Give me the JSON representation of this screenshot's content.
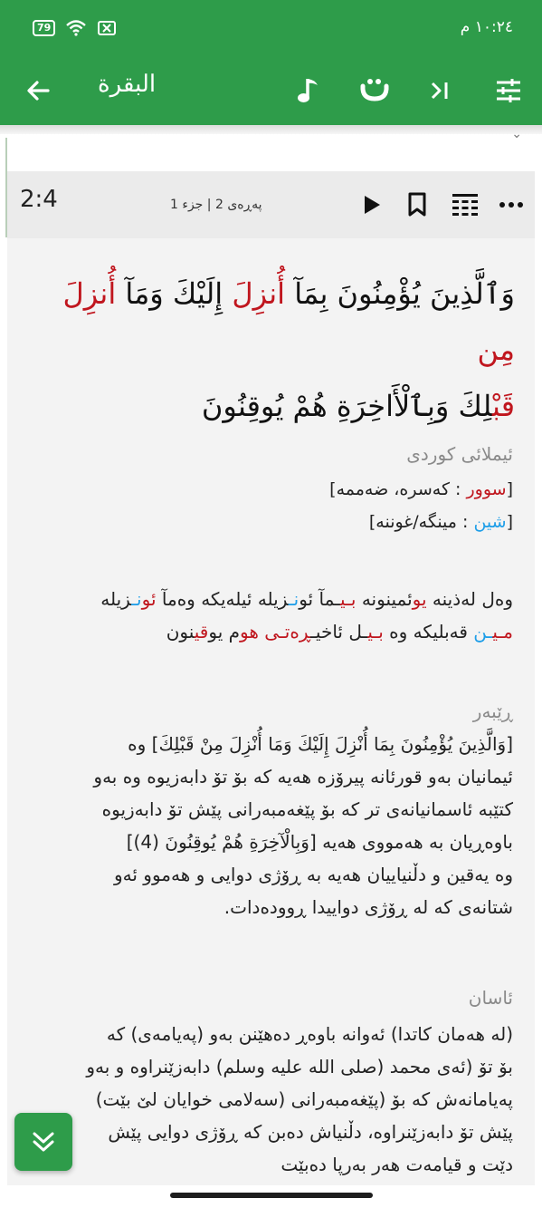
{
  "status_bar": {
    "battery": "79",
    "time": "١٠:٢٤ م"
  },
  "toolbar": {
    "title": "البقرة",
    "icons": [
      "back-arrow-icon",
      "music-note-icon",
      "ta-letter-icon",
      "skip-icon",
      "tune-sliders-icon"
    ]
  },
  "ayah_header": {
    "ayah_number": "2:4",
    "juz_label": "پەڕەی 2 | جزء 1",
    "icons": [
      "play-icon",
      "bookmark-icon",
      "grid-icon",
      "more-icon"
    ]
  },
  "arabic": {
    "line1": [
      {
        "t": "وَٱلَّذِينَ يُؤْمِنُونَ بِمَآ ",
        "c": ""
      },
      {
        "t": "أُنزِلَ",
        "c": "red"
      },
      {
        "t": " إِلَيْكَ وَمَآ ",
        "c": ""
      },
      {
        "t": "أُنزِلَ",
        "c": "red"
      },
      {
        "t": " ",
        "c": ""
      },
      {
        "t": "مِن",
        "c": "red"
      }
    ],
    "line2": [
      {
        "t": "قَبْ",
        "c": "red"
      },
      {
        "t": "لِكَ وَبِٱلْأَاخِرَةِ هُمْ يُوقِنُونَ",
        "c": ""
      }
    ]
  },
  "kurdish_spelling": {
    "title": "ئیملائی کوردی",
    "legend_red_color": "سوور",
    "legend_red_meaning": " : کەسرە، ضەممە",
    "legend_blue_color": "شین",
    "legend_blue_meaning": " : مینگە/غوننە",
    "line1": [
      {
        "t": "وەل لەذینە ",
        "c": ""
      },
      {
        "t": "یو",
        "c": "red"
      },
      {
        "t": "ئمینونە ",
        "c": ""
      },
      {
        "t": "بـی",
        "c": "red"
      },
      {
        "t": "ـمآ ئو",
        "c": ""
      },
      {
        "t": "نـ",
        "c": "blue"
      },
      {
        "t": "زیلە ئیلەیکە وەمآ ",
        "c": ""
      },
      {
        "t": "ئو",
        "c": "red"
      },
      {
        "t": "نـ",
        "c": "blue"
      },
      {
        "t": "زیلە",
        "c": ""
      }
    ],
    "line2": [
      {
        "t": "مـی",
        "c": "red"
      },
      {
        "t": "ـن",
        "c": "blue"
      },
      {
        "t": " قەبلیکە وە ",
        "c": ""
      },
      {
        "t": "بـی",
        "c": "red"
      },
      {
        "t": "ـل ئاخیـ",
        "c": ""
      },
      {
        "t": "ڕە",
        "c": "red"
      },
      {
        "t": "تـی",
        "c": "red"
      },
      {
        "t": " ",
        "c": ""
      },
      {
        "t": "هو",
        "c": "red"
      },
      {
        "t": "م یو",
        "c": ""
      },
      {
        "t": "قی",
        "c": "red"
      },
      {
        "t": "نون",
        "c": ""
      }
    ]
  },
  "rebar": {
    "title": "ڕێبەر",
    "lines": [
      "[وَالَّذِينَ يُؤْمِنُونَ بِمَا أُنْزِلَ إِلَيْكَ وَمَا أُنْزِلَ مِنْ قَبْلِكَ] وە",
      "ئیمانیان بەو قورئانە پیرۆزە هەیە کە بۆ تۆ دابەزیوە وە بەو",
      "کتێبە ئاسمانیانەی تر کە بۆ پێغەمبەرانی پێش تۆ دابەزیوە",
      "باوەڕیان بە هەمووی هەیە [وَبِالْآخِرَةِ هُمْ يُوقِنُونَ (4)]",
      "وە یەقین و دڵنیاییان هەیە بە ڕۆژی دوایی و هەموو ئەو",
      "شتانەی کە لە ڕۆژی دواییدا ڕوودەدات."
    ]
  },
  "asan": {
    "title": "ئاسان",
    "lines": [
      "(لە هەمان کاتدا) ئەوانە باوەڕ دەهێنن بەو (پەیامەی) کە",
      "بۆ تۆ (ئەی محمد (صلی الله علیه وسلم) دابەزێنراوە و بەو",
      "پەیامانەش کە بۆ (پێغەمبەرانی (سەلامی خوایان لێ بێت)",
      "پێش تۆ دابەزێنراوە، دڵنیاش دەبن کە ڕۆژی دوایی پێش",
      "دێت و قیامەت هەر بەرپا دەبێت"
    ]
  },
  "colors": {
    "green": "#2e9c4a",
    "red": "#c0161e",
    "blue": "#1e9ee8"
  }
}
